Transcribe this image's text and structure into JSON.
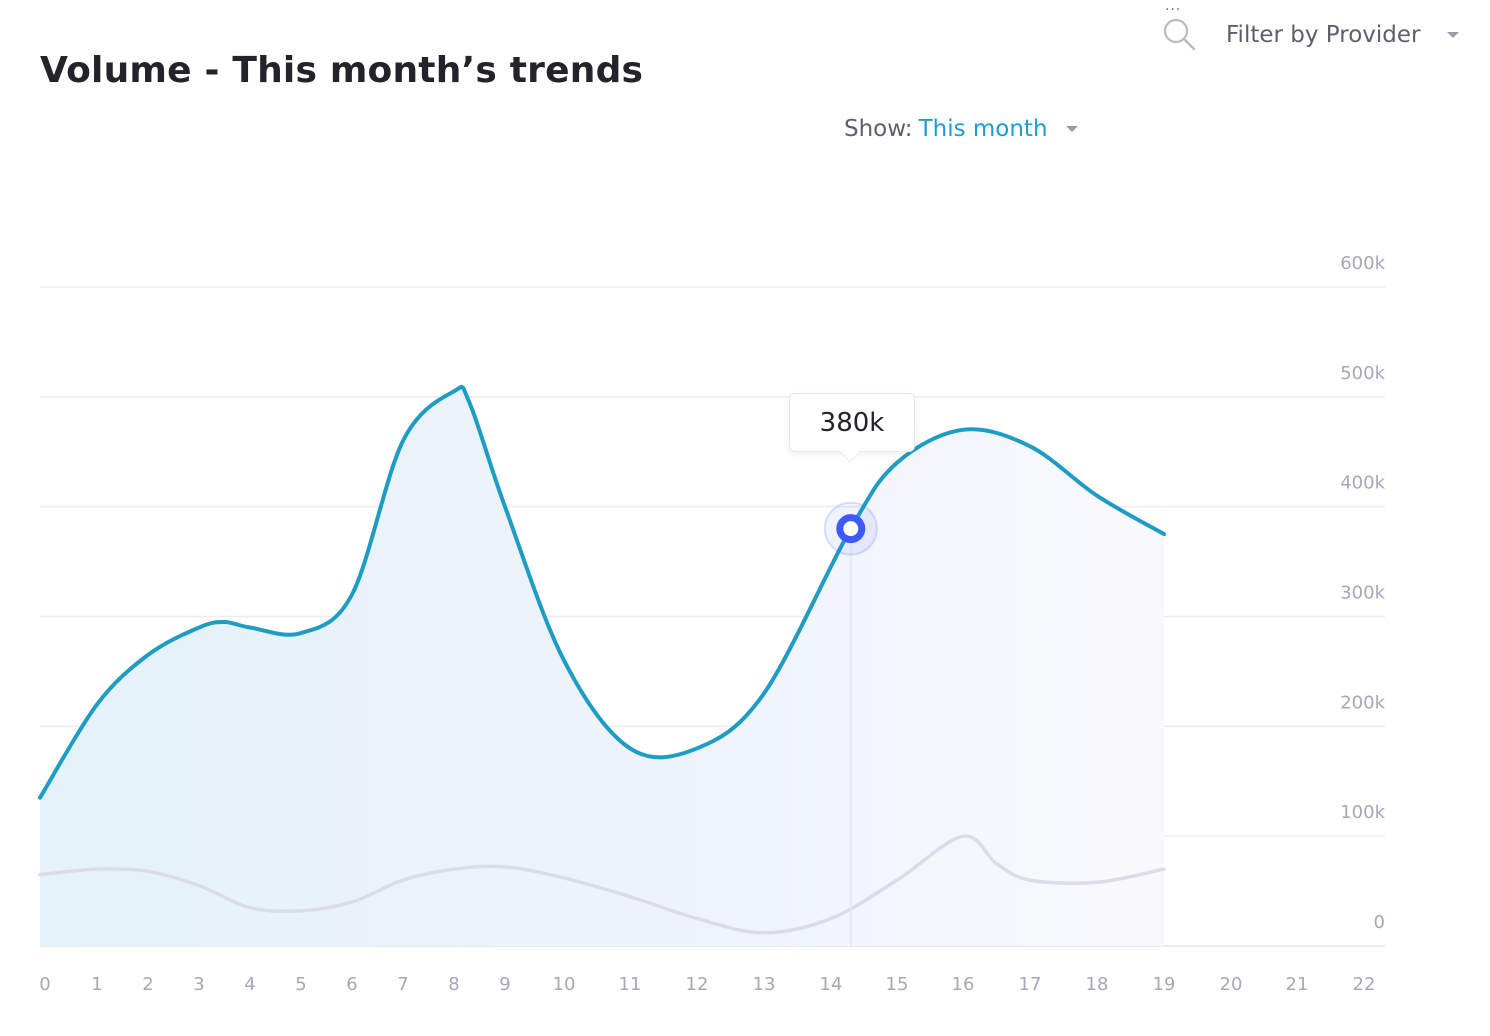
{
  "header": {
    "title": "Volume - This month’s trends",
    "more_label": "...",
    "filter_label": "Filter by Provider"
  },
  "show": {
    "label": "Show:",
    "value": "This month"
  },
  "tooltip": {
    "text": "380k"
  },
  "icons": {
    "search": "search-icon",
    "filter_dropdown": "chevron-down-icon",
    "show_dropdown": "chevron-down-icon"
  },
  "colors": {
    "primary_line": "#1f9cc4",
    "secondary_line": "#dcdce8",
    "marker": "#3d5afe",
    "accent_text": "#1f9bd6"
  },
  "chart_data": {
    "type": "area",
    "xlim": [
      0,
      22
    ],
    "ylim": [
      0,
      600000
    ],
    "x_ticks": [
      "0",
      "1",
      "2",
      "3",
      "4",
      "5",
      "6",
      "7",
      "8",
      "9",
      "10",
      "11",
      "12",
      "13",
      "14",
      "15",
      "16",
      "17",
      "18",
      "19",
      "20",
      "21",
      "22"
    ],
    "y_ticks": [
      "0",
      "100k",
      "200k",
      "300k",
      "400k",
      "500k",
      "600k"
    ],
    "grid": true,
    "series": [
      {
        "x": [
          0,
          1,
          2,
          3,
          3.5,
          4,
          5,
          6,
          7,
          8,
          8.3,
          9,
          10,
          11,
          12,
          13,
          14.3,
          15,
          16,
          17,
          18,
          19
        ],
        "y": [
          135000,
          220000,
          265000,
          290000,
          295000,
          290000,
          285000,
          320000,
          460000,
          505000,
          495000,
          400000,
          260000,
          180000,
          180000,
          230000,
          380000,
          440000,
          470000,
          455000,
          410000,
          375000
        ]
      },
      {
        "x": [
          0,
          1,
          2,
          3,
          4,
          5,
          6,
          7,
          8,
          9,
          10,
          11,
          12,
          13,
          14,
          15,
          16,
          16.5,
          17,
          18,
          19
        ],
        "y": [
          65000,
          70000,
          68000,
          55000,
          35000,
          32000,
          40000,
          60000,
          70000,
          72000,
          62000,
          45000,
          25000,
          12000,
          25000,
          60000,
          100000,
          75000,
          60000,
          58000,
          70000
        ]
      }
    ],
    "highlight": {
      "x": 14.3,
      "y": 380000,
      "label": "380k"
    }
  }
}
